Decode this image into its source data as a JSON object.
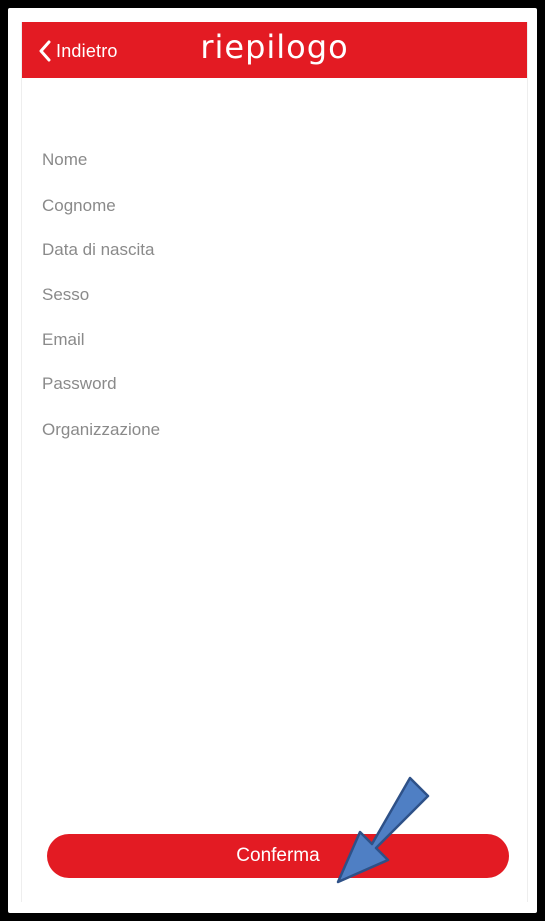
{
  "header": {
    "back_label": "Indietro",
    "title": "riepilogo"
  },
  "fields": [
    {
      "label": "Nome"
    },
    {
      "label": "Cognome"
    },
    {
      "label": "Data di nascita"
    },
    {
      "label": "Sesso"
    },
    {
      "label": "Email"
    },
    {
      "label": "Password"
    },
    {
      "label": "Organizzazione"
    }
  ],
  "footer": {
    "confirm_label": "Conferma"
  },
  "colors": {
    "brand_red": "#e31b23",
    "label_gray": "#8a8a8a",
    "arrow_blue": "#4f7fc4"
  },
  "icons": {
    "back": "chevron-left-icon",
    "annotation": "arrow-pointer-icon"
  }
}
